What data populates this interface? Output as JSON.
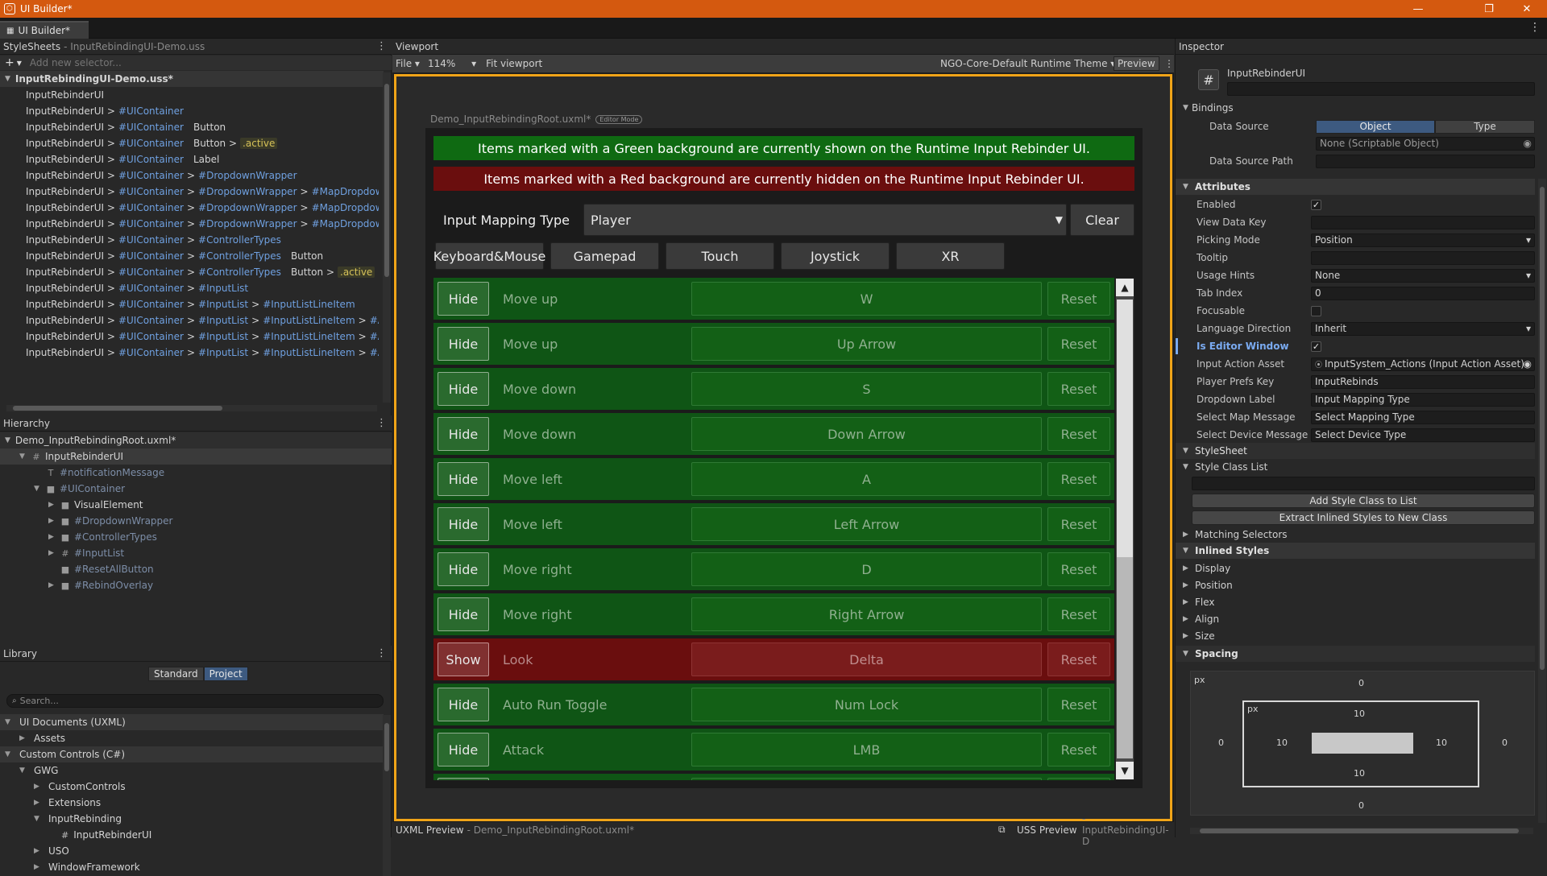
{
  "window": {
    "title": "UI Builder*",
    "tab": "UI Builder*"
  },
  "stylesheets": {
    "header": "StyleSheets",
    "subheader": "- InputRebindingUI-Demo.uss",
    "add_placeholder": "Add new selector...",
    "file": "InputRebindingUI-Demo.uss*",
    "selectors": [
      {
        "base": "InputRebinderUI",
        "parts": []
      },
      {
        "base": "InputRebinderUI >",
        "parts": [
          "#UIContainer"
        ]
      },
      {
        "base": "InputRebinderUI >",
        "parts": [
          "#UIContainer"
        ],
        "tail": "Button"
      },
      {
        "base": "InputRebinderUI >",
        "parts": [
          "#UIContainer"
        ],
        "tail": "Button >",
        "active": ".active"
      },
      {
        "base": "InputRebinderUI >",
        "parts": [
          "#UIContainer"
        ],
        "tail": "Label"
      },
      {
        "base": "InputRebinderUI >",
        "parts": [
          "#UIContainer",
          ">",
          "#DropdownWrapper"
        ]
      },
      {
        "base": "InputRebinderUI >",
        "parts": [
          "#UIContainer",
          ">",
          "#DropdownWrapper",
          ">",
          "#MapDropdown",
          ">"
        ]
      },
      {
        "base": "InputRebinderUI >",
        "parts": [
          "#UIContainer",
          ">",
          "#DropdownWrapper",
          ">",
          "#MapDropdown",
          ">"
        ]
      },
      {
        "base": "InputRebinderUI >",
        "parts": [
          "#UIContainer",
          ">",
          "#DropdownWrapper",
          ">",
          "#MapDropdown",
          ">"
        ]
      },
      {
        "base": "InputRebinderUI >",
        "parts": [
          "#UIContainer",
          ">",
          "#ControllerTypes"
        ]
      },
      {
        "base": "InputRebinderUI >",
        "parts": [
          "#UIContainer",
          ">",
          "#ControllerTypes"
        ],
        "tail": "Button"
      },
      {
        "base": "InputRebinderUI >",
        "parts": [
          "#UIContainer",
          ">",
          "#ControllerTypes"
        ],
        "tail": "Button >",
        "active": ".active"
      },
      {
        "base": "InputRebinderUI >",
        "parts": [
          "#UIContainer",
          ">",
          "#InputList"
        ]
      },
      {
        "base": "InputRebinderUI >",
        "parts": [
          "#UIContainer",
          ">",
          "#InputList",
          ">",
          "#InputListLineItem"
        ]
      },
      {
        "base": "InputRebinderUI >",
        "parts": [
          "#UIContainer",
          ">",
          "#InputList",
          ">",
          "#InputListLineItem",
          ">",
          "#ActionF"
        ]
      },
      {
        "base": "InputRebinderUI >",
        "parts": [
          "#UIContainer",
          ">",
          "#InputList",
          ">",
          "#InputListLineItem",
          ">",
          "#ActionL"
        ]
      },
      {
        "base": "InputRebinderUI >",
        "parts": [
          "#UIContainer",
          ">",
          "#InputList",
          ">",
          "#InputListLineItem",
          ">",
          "#ActionL"
        ]
      }
    ]
  },
  "hierarchy": {
    "header": "Hierarchy",
    "root": "Demo_InputRebindingRoot.uxml*",
    "items": [
      {
        "label": "InputRebinderUI",
        "indent": 1,
        "tri": "▼",
        "icon": "#"
      },
      {
        "label": "#notificationMessage",
        "indent": 2,
        "tri": "",
        "icon": "T",
        "dim": true
      },
      {
        "label": "#UIContainer",
        "indent": 2,
        "tri": "▼",
        "icon": "■",
        "dim": true
      },
      {
        "label": "VisualElement",
        "indent": 3,
        "tri": "▶",
        "icon": "■"
      },
      {
        "label": "#DropdownWrapper",
        "indent": 3,
        "tri": "▶",
        "icon": "■",
        "dim": true
      },
      {
        "label": "#ControllerTypes",
        "indent": 3,
        "tri": "▶",
        "icon": "■",
        "dim": true
      },
      {
        "label": "#InputList",
        "indent": 3,
        "tri": "▶",
        "icon": "#",
        "dim": true
      },
      {
        "label": "#ResetAllButton",
        "indent": 3,
        "tri": "",
        "icon": "■",
        "dim": true
      },
      {
        "label": "#RebindOverlay",
        "indent": 3,
        "tri": "▶",
        "icon": "■",
        "dim": true
      }
    ]
  },
  "library": {
    "header": "Library",
    "tabs": [
      "Standard",
      "Project"
    ],
    "search_placeholder": "Search...",
    "items": [
      {
        "label": "UI Documents (UXML)",
        "indent": 0,
        "tri": "▼",
        "section": true
      },
      {
        "label": "Assets",
        "indent": 1,
        "tri": "▶"
      },
      {
        "label": "Custom Controls (C#)",
        "indent": 0,
        "tri": "▼",
        "section": true
      },
      {
        "label": "GWG",
        "indent": 1,
        "tri": "▼"
      },
      {
        "label": "CustomControls",
        "indent": 2,
        "tri": "▶"
      },
      {
        "label": "Extensions",
        "indent": 2,
        "tri": "▶"
      },
      {
        "label": "InputRebinding",
        "indent": 2,
        "tri": "▼"
      },
      {
        "label": "InputRebinderUI",
        "indent": 3,
        "tri": "",
        "icon": "#"
      },
      {
        "label": "USO",
        "indent": 2,
        "tri": "▶"
      },
      {
        "label": "WindowFramework",
        "indent": 2,
        "tri": "▶"
      }
    ]
  },
  "viewport": {
    "header": "Viewport",
    "file_menu": "File",
    "zoom": "114%",
    "fit": "Fit viewport",
    "theme": "NGO-Core-Default Runtime Theme",
    "preview": "Preview",
    "canvas_title": "Demo_InputRebindingRoot.uxml*",
    "editor_mode": "Editor Mode",
    "banner_green": "Items marked with a Green background are currently shown on the Runtime Input Rebinder UI.",
    "banner_red": "Items marked with a Red background are currently hidden on the Runtime Input Rebinder UI.",
    "mapping_label": "Input Mapping Type",
    "mapping_value": "Player",
    "clear": "Clear",
    "device_tabs": [
      "Keyboard&Mouse",
      "Gamepad",
      "Touch",
      "Joystick",
      "XR"
    ],
    "rows": [
      {
        "toggle": "Hide",
        "action": "Move up",
        "binding": "W",
        "reset": "Reset",
        "state": "g"
      },
      {
        "toggle": "Hide",
        "action": "Move up",
        "binding": "Up Arrow",
        "reset": "Reset",
        "state": "g"
      },
      {
        "toggle": "Hide",
        "action": "Move down",
        "binding": "S",
        "reset": "Reset",
        "state": "g"
      },
      {
        "toggle": "Hide",
        "action": "Move down",
        "binding": "Down Arrow",
        "reset": "Reset",
        "state": "g"
      },
      {
        "toggle": "Hide",
        "action": "Move left",
        "binding": "A",
        "reset": "Reset",
        "state": "g"
      },
      {
        "toggle": "Hide",
        "action": "Move left",
        "binding": "Left Arrow",
        "reset": "Reset",
        "state": "g"
      },
      {
        "toggle": "Hide",
        "action": "Move right",
        "binding": "D",
        "reset": "Reset",
        "state": "g"
      },
      {
        "toggle": "Hide",
        "action": "Move right",
        "binding": "Right Arrow",
        "reset": "Reset",
        "state": "g"
      },
      {
        "toggle": "Show",
        "action": "Look",
        "binding": "Delta",
        "reset": "Reset",
        "state": "r"
      },
      {
        "toggle": "Hide",
        "action": "Auto Run Toggle",
        "binding": "Num Lock",
        "reset": "Reset",
        "state": "g"
      },
      {
        "toggle": "Hide",
        "action": "Attack",
        "binding": "LMB",
        "reset": "Reset",
        "state": "g"
      },
      {
        "toggle": "Hide",
        "action": "",
        "binding": "",
        "reset": "Reset",
        "state": "g"
      }
    ]
  },
  "bottom": {
    "uxml_preview": "UXML Preview",
    "uxml_file": "- Demo_InputRebindingRoot.uxml*",
    "uss_preview": "USS Preview",
    "uss_file": "- InputRebindingUI-D"
  },
  "inspector": {
    "header": "Inspector",
    "element": "InputRebinderUI",
    "bindings": "Bindings",
    "data_source_label": "Data Source",
    "ds_tabs": [
      "Object",
      "Type"
    ],
    "ds_value": "None (Scriptable Object)",
    "data_source_path": "Data Source Path",
    "attributes": "Attributes",
    "fields": [
      {
        "label": "Enabled",
        "type": "check",
        "value": "✓"
      },
      {
        "label": "View Data Key",
        "type": "text",
        "value": ""
      },
      {
        "label": "Picking Mode",
        "type": "dropdown",
        "value": "Position"
      },
      {
        "label": "Tooltip",
        "type": "text",
        "value": ""
      },
      {
        "label": "Usage Hints",
        "type": "dropdown",
        "value": "None"
      },
      {
        "label": "Tab Index",
        "type": "text",
        "value": "0"
      },
      {
        "label": "Focusable",
        "type": "check",
        "value": ""
      },
      {
        "label": "Language Direction",
        "type": "dropdown",
        "value": "Inherit"
      },
      {
        "label": "Is Editor Window",
        "type": "check",
        "value": "✓",
        "highlight": true
      },
      {
        "label": "Input Action Asset",
        "type": "text",
        "value": "InputSystem_Actions (Input Action Asset)"
      },
      {
        "label": "Player Prefs Key",
        "type": "text",
        "value": "InputRebinds"
      },
      {
        "label": "Dropdown Label",
        "type": "text",
        "value": "Input Mapping Type"
      },
      {
        "label": "Select Map Message",
        "type": "text",
        "value": "Select Mapping Type"
      },
      {
        "label": "Select Device Message",
        "type": "text",
        "value": "Select Device Type"
      }
    ],
    "stylesheet": "StyleSheet",
    "style_class_list": "Style Class List",
    "add_style_class": "Add Style Class to List",
    "extract_styles": "Extract Inlined Styles to New Class",
    "matching_selectors": "Matching Selectors",
    "inlined_styles": "Inlined Styles",
    "folds": [
      "Display",
      "Position",
      "Flex",
      "Align",
      "Size"
    ],
    "spacing": "Spacing",
    "spacing_box": {
      "outer_unit": "px",
      "inner_unit": "px",
      "margin_top": "0",
      "margin_left": "0",
      "margin_right": "0",
      "margin_bottom": "0",
      "padding_top": "10",
      "padding_left": "10",
      "padding_right": "10",
      "padding_bottom": "10"
    }
  }
}
